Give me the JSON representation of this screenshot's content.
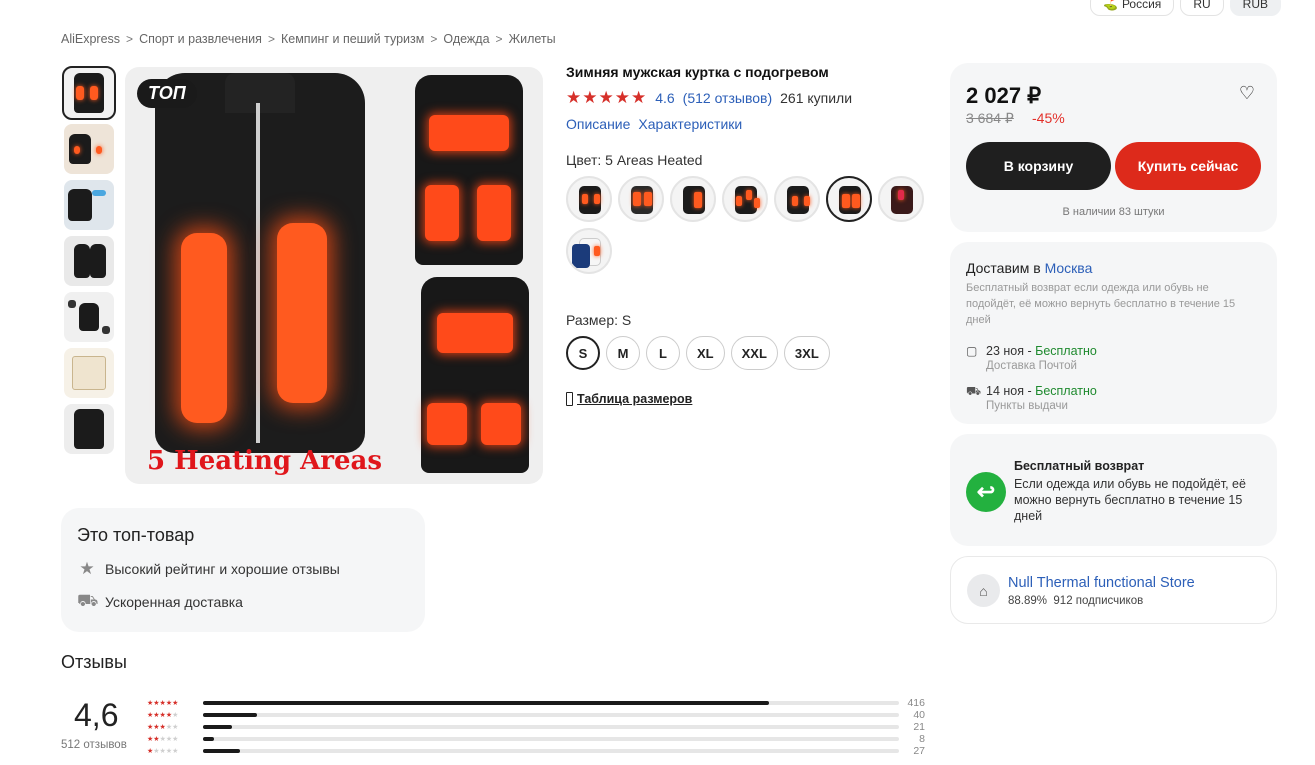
{
  "top_chips": {
    "region": "Россия",
    "lang": "RU",
    "currency": "RUB"
  },
  "breadcrumbs": [
    "AliExpress",
    "Спорт и развлечения",
    "Кемпинг и пеший туризм",
    "Одежда",
    "Жилеты"
  ],
  "gallery": {
    "badge": "ТОП",
    "image_caption": "5 Heating Areas",
    "thumbnail_count": 7
  },
  "product": {
    "title": "Зимняя мужская куртка с подогревом",
    "stars": "★★★★★",
    "rating": "4.6",
    "reviews_link": "(512 отзывов)",
    "bought": "261 купили",
    "link_description": "Описание",
    "link_specs": "Характеристики",
    "color_label": "Цвет: 5 Areas Heated",
    "size_label": "Размер: S",
    "sizes": [
      "S",
      "M",
      "L",
      "XL",
      "XXL",
      "3XL"
    ],
    "selected_size": "S",
    "size_table": "Таблица размеров"
  },
  "price_card": {
    "price": "2 027 ₽",
    "old_price": "3 684 ₽",
    "discount": "-45%",
    "cart_button": "В корзину",
    "buy_button": "Купить сейчас",
    "stock": "В наличии 83 штуки"
  },
  "delivery": {
    "title_prefix": "Доставим в ",
    "city": "Москва",
    "return_note": "Бесплатный возврат если одежда или обувь не подойдёт, её можно вернуть бесплатно в течение 15 дней",
    "option1_date": "23 ноя - ",
    "option1_price": "Бесплатно",
    "option1_sub": "Доставка Почтой",
    "option2_date": "14 ноя - ",
    "option2_price": "Бесплатно",
    "option2_sub": "Пункты выдачи"
  },
  "free_return": {
    "title": "Бесплатный возврат",
    "text": "Если одежда или обувь не подойдёт, её можно вернуть бесплатно в течение 15 дней"
  },
  "store": {
    "name": "Null Thermal functional Store",
    "rating": "88.89%",
    "subscribers": "912 подписчиков"
  },
  "top_product": {
    "title": "Это топ-товар",
    "item1": "Высокий рейтинг и хорошие отзывы",
    "item2": "Ускоренная доставка"
  },
  "reviews": {
    "title": "Отзывы",
    "score": "4,6",
    "count": "512 отзывов",
    "distribution": [
      {
        "stars": 5,
        "count": 416
      },
      {
        "stars": 4,
        "count": 40
      },
      {
        "stars": 3,
        "count": 21
      },
      {
        "stars": 2,
        "count": 8
      },
      {
        "stars": 1,
        "count": 27
      }
    ]
  },
  "colors": {
    "accent_red": "#dd2a1b",
    "link_blue": "#2c5fb8",
    "free_green": "#1e8a2e",
    "star_red": "#d6302a"
  }
}
